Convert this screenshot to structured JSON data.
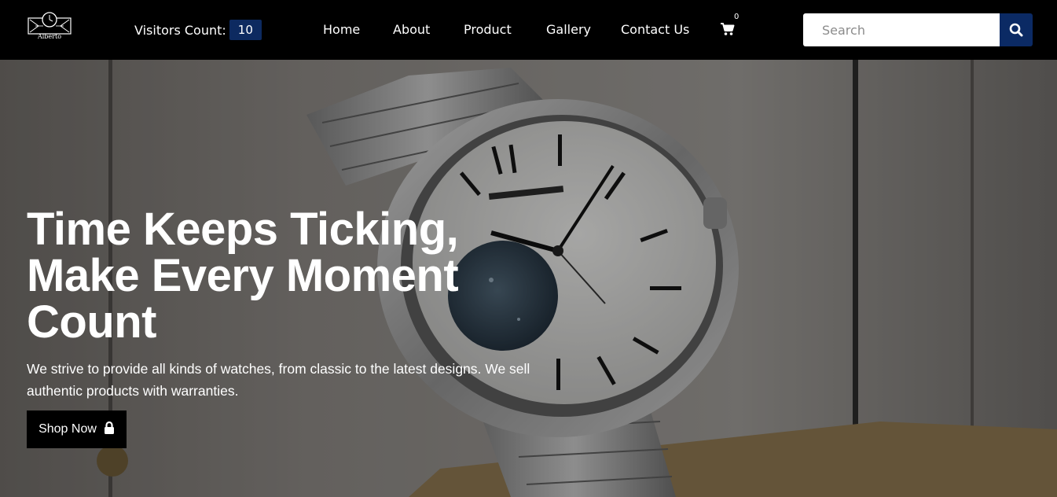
{
  "brand": {
    "name": "Alberto"
  },
  "visitors": {
    "label": "Visitors Count:",
    "count": "10"
  },
  "nav": {
    "items": [
      {
        "label": "Home"
      },
      {
        "label": "About"
      },
      {
        "label": "Product"
      },
      {
        "label": "Gallery"
      },
      {
        "label": "Contact Us"
      }
    ],
    "cart_count": "0",
    "cart_icon": "shopping-cart-icon"
  },
  "search": {
    "placeholder": "Search",
    "value": "",
    "icon": "search-icon"
  },
  "hero": {
    "title_lines": [
      "Time Keeps Ticking,",
      "Make Every Moment",
      "Count"
    ],
    "subtitle": "We strive to provide all kinds of watches, from classic to the latest designs. We sell authentic products with warranties.",
    "cta_label": "Shop Now",
    "cta_icon": "lock-icon",
    "background": "wristwatch-photo"
  },
  "colors": {
    "navbar_bg": "#000000",
    "accent_navy": "#0b2a64",
    "cta_bg": "#000000",
    "text": "#ffffff"
  }
}
